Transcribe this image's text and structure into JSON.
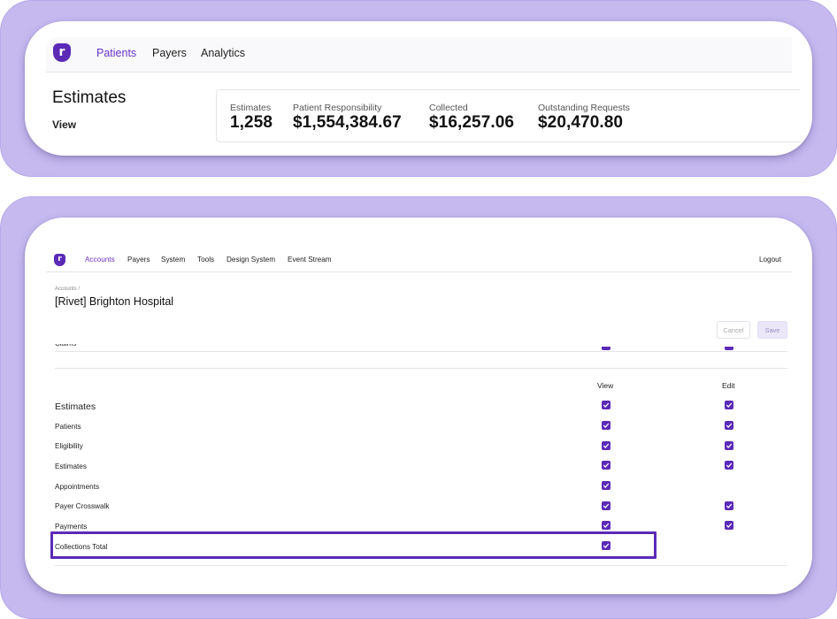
{
  "top": {
    "logo_letter": "r",
    "nav": [
      "Patients",
      "Payers",
      "Analytics"
    ],
    "active_nav": "Patients",
    "page_title": "Estimates",
    "view_label": "View",
    "stats": [
      {
        "label": "Estimates",
        "value": "1,258"
      },
      {
        "label": "Patient Responsibility",
        "value": "$1,554,384.67"
      },
      {
        "label": "Collected",
        "value": "$16,257.06"
      },
      {
        "label": "Outstanding Requests",
        "value": "$20,470.80"
      }
    ]
  },
  "bottom": {
    "logo_letter": "r",
    "nav": [
      "Accounts",
      "Payers",
      "System",
      "Tools",
      "Design System",
      "Event Stream"
    ],
    "active_nav": "Accounts",
    "logout": "Logout",
    "breadcrumb": "Accounts /",
    "account_name": "[Rivet] Brighton Hospital",
    "cancel_label": "Cancel",
    "save_label": "Save",
    "clipped_row": "Claims",
    "columns": {
      "view": "View",
      "edit": "Edit"
    },
    "section": "Estimates",
    "rows": [
      {
        "label": "Patients",
        "view": true,
        "edit": true
      },
      {
        "label": "Eligibility",
        "view": true,
        "edit": true
      },
      {
        "label": "Estimates",
        "view": true,
        "edit": true
      },
      {
        "label": "Appointments",
        "view": true,
        "edit": false
      },
      {
        "label": "Payer Crosswalk",
        "view": true,
        "edit": true
      },
      {
        "label": "Payments",
        "view": true,
        "edit": true
      },
      {
        "label": "Collections Total",
        "view": true,
        "edit": false,
        "highlighted": true
      }
    ],
    "colors": {
      "accent": "#5b2ab7",
      "nav_active": "#6a35c6",
      "frame": "#c5b9f0"
    }
  }
}
